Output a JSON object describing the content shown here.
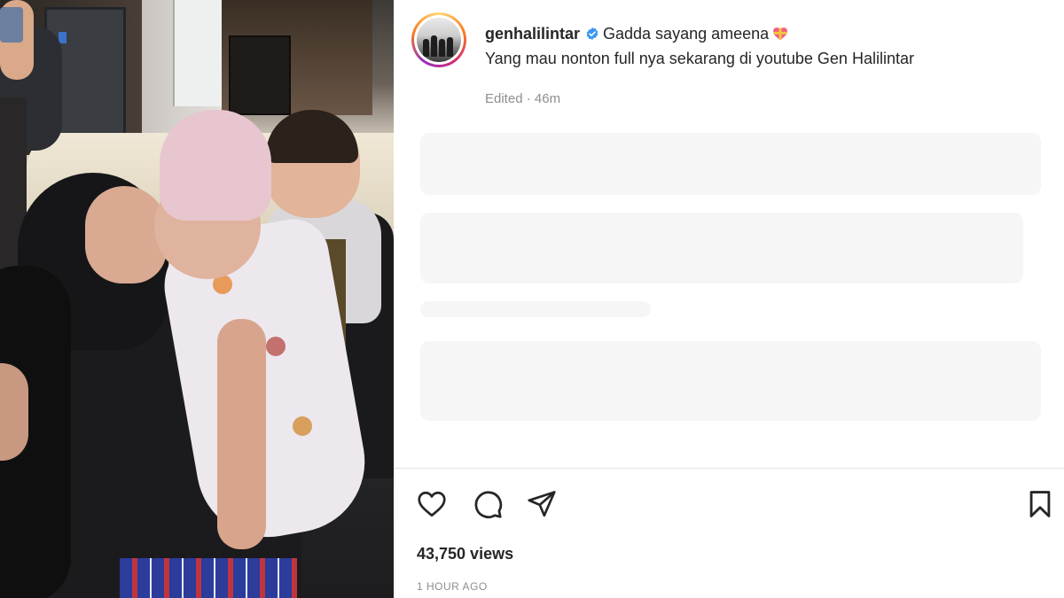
{
  "post": {
    "username": "genhalilintar",
    "verified": true,
    "caption_line1": "Gadda sayang ameena",
    "caption_emoji": "heart-with-ribbon-emoji",
    "caption_line2": "Yang mau nonton full nya sekarang di youtube Gen Halilintar",
    "edited_label": "Edited",
    "edited_separator": "·",
    "edited_time": "46m",
    "views": "43,750 views",
    "posted_time": "1 HOUR AGO"
  },
  "actions": {
    "like_icon": "heart-icon",
    "comment_icon": "comment-icon",
    "share_icon": "share-icon",
    "save_icon": "bookmark-icon"
  },
  "colors": {
    "verified_blue": "#3897f0",
    "text_primary": "#262626",
    "text_secondary": "#8e8e8e",
    "story_ring_start": "#feda75",
    "story_ring_end": "#962fbf"
  }
}
